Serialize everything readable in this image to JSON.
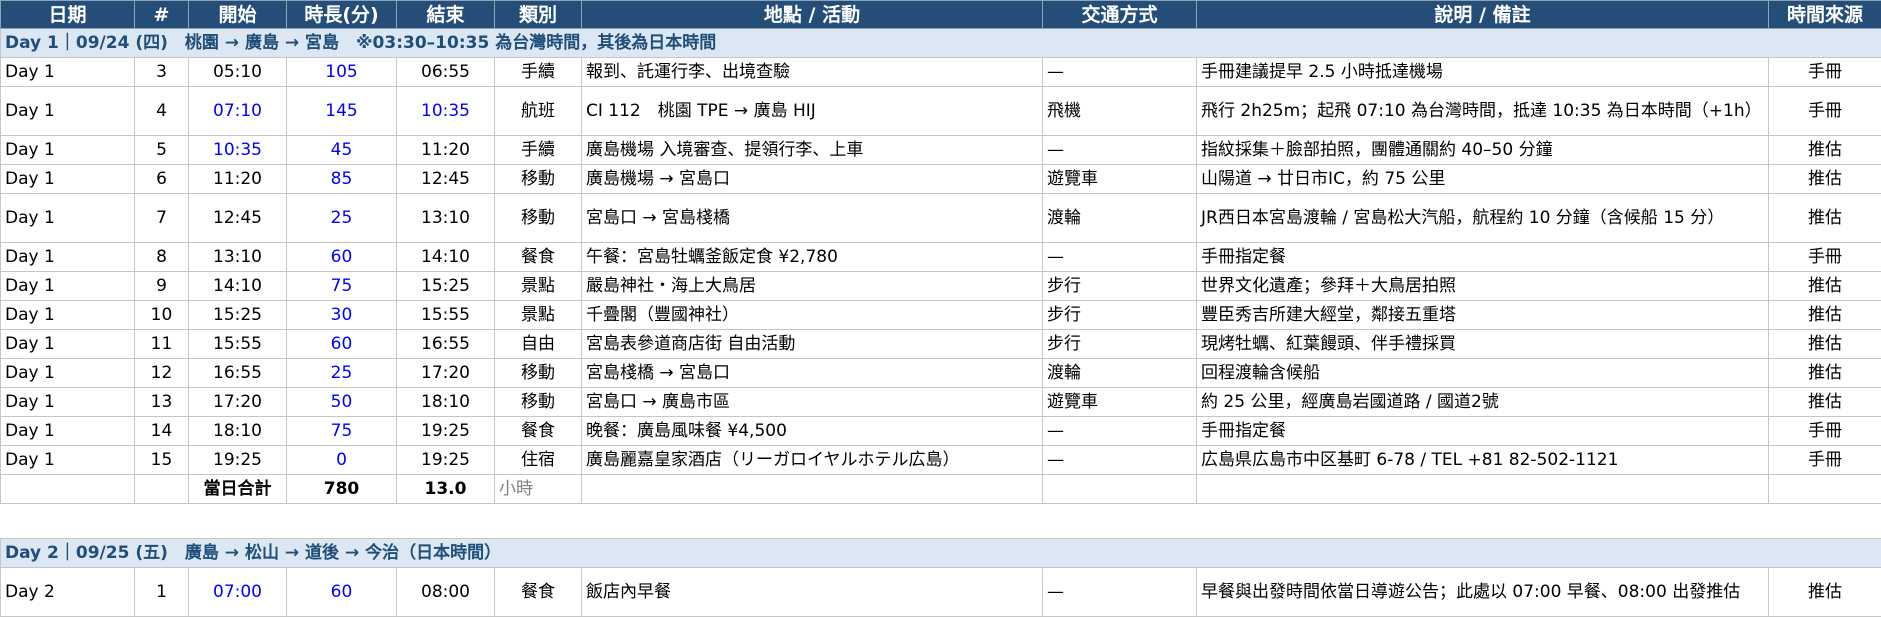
{
  "headers": [
    "日期",
    "#",
    "開始",
    "時長(分)",
    "結束",
    "類別",
    "地點 / 活動",
    "交通方式",
    "說明 / 備註",
    "時間來源"
  ],
  "days": [
    {
      "banner": "Day 1｜09/24 (四)　桃園 → 廣島 → 宮島　※03:30–10:35 為台灣時間，其後為日本時間",
      "rows": [
        {
          "day": "Day 1",
          "no": "3",
          "start": "05:10",
          "start_blue": false,
          "dur": "105",
          "end": "06:55",
          "end_blue": false,
          "cat": "手續",
          "place": "報到、託運行李、出境查驗",
          "trans": "—",
          "note": "手冊建議提早 2.5 小時抵達機場",
          "src": "手冊",
          "tall": false
        },
        {
          "day": "Day 1",
          "no": "4",
          "start": "07:10",
          "start_blue": true,
          "dur": "145",
          "end": "10:35",
          "end_blue": true,
          "cat": "航班",
          "place": "CI 112　桃園 TPE → 廣島 HIJ",
          "trans": "飛機",
          "note": "飛行 2h25m；起飛 07:10 為台灣時間，抵達 10:35 為日本時間（+1h）",
          "src": "手冊",
          "tall": true
        },
        {
          "day": "Day 1",
          "no": "5",
          "start": "10:35",
          "start_blue": true,
          "dur": "45",
          "end": "11:20",
          "end_blue": false,
          "cat": "手續",
          "place": "廣島機場 入境審查、提領行李、上車",
          "trans": "—",
          "note": "指紋採集＋臉部拍照，團體通關約 40–50 分鐘",
          "src": "推估",
          "tall": false
        },
        {
          "day": "Day 1",
          "no": "6",
          "start": "11:20",
          "start_blue": false,
          "dur": "85",
          "end": "12:45",
          "end_blue": false,
          "cat": "移動",
          "place": "廣島機場 → 宮島口",
          "trans": "遊覽車",
          "note": "山陽道 → 廿日市IC，約 75 公里",
          "src": "推估",
          "tall": false
        },
        {
          "day": "Day 1",
          "no": "7",
          "start": "12:45",
          "start_blue": false,
          "dur": "25",
          "end": "13:10",
          "end_blue": false,
          "cat": "移動",
          "place": "宮島口 → 宮島棧橋",
          "trans": "渡輪",
          "note": "JR西日本宮島渡輪 / 宮島松大汽船，航程約 10 分鐘（含候船 15 分）",
          "src": "推估",
          "tall": true
        },
        {
          "day": "Day 1",
          "no": "8",
          "start": "13:10",
          "start_blue": false,
          "dur": "60",
          "end": "14:10",
          "end_blue": false,
          "cat": "餐食",
          "place": "午餐：宮島牡蠣釜飯定食 ¥2,780",
          "trans": "—",
          "note": "手冊指定餐",
          "src": "手冊",
          "tall": false
        },
        {
          "day": "Day 1",
          "no": "9",
          "start": "14:10",
          "start_blue": false,
          "dur": "75",
          "end": "15:25",
          "end_blue": false,
          "cat": "景點",
          "place": "嚴島神社・海上大鳥居",
          "trans": "步行",
          "note": "世界文化遺產；參拜＋大鳥居拍照",
          "src": "推估",
          "tall": false
        },
        {
          "day": "Day 1",
          "no": "10",
          "start": "15:25",
          "start_blue": false,
          "dur": "30",
          "end": "15:55",
          "end_blue": false,
          "cat": "景點",
          "place": "千疊閣（豐國神社）",
          "trans": "步行",
          "note": "豐臣秀吉所建大經堂，鄰接五重塔",
          "src": "推估",
          "tall": false
        },
        {
          "day": "Day 1",
          "no": "11",
          "start": "15:55",
          "start_blue": false,
          "dur": "60",
          "end": "16:55",
          "end_blue": false,
          "cat": "自由",
          "place": "宮島表參道商店街 自由活動",
          "trans": "步行",
          "note": "現烤牡蠣、紅葉饅頭、伴手禮採買",
          "src": "推估",
          "tall": false
        },
        {
          "day": "Day 1",
          "no": "12",
          "start": "16:55",
          "start_blue": false,
          "dur": "25",
          "end": "17:20",
          "end_blue": false,
          "cat": "移動",
          "place": "宮島棧橋 → 宮島口",
          "trans": "渡輪",
          "note": "回程渡輪含候船",
          "src": "推估",
          "tall": false
        },
        {
          "day": "Day 1",
          "no": "13",
          "start": "17:20",
          "start_blue": false,
          "dur": "50",
          "end": "18:10",
          "end_blue": false,
          "cat": "移動",
          "place": "宮島口 → 廣島市區",
          "trans": "遊覽車",
          "note": "約 25 公里，經廣島岩國道路 / 國道2號",
          "src": "推估",
          "tall": false
        },
        {
          "day": "Day 1",
          "no": "14",
          "start": "18:10",
          "start_blue": false,
          "dur": "75",
          "end": "19:25",
          "end_blue": false,
          "cat": "餐食",
          "place": "晚餐：廣島風味餐 ¥4,500",
          "trans": "—",
          "note": "手冊指定餐",
          "src": "手冊",
          "tall": false
        },
        {
          "day": "Day 1",
          "no": "15",
          "start": "19:25",
          "start_blue": false,
          "dur": "0",
          "end": "19:25",
          "end_blue": false,
          "cat": "住宿",
          "place": "廣島麗嘉皇家酒店（リーガロイヤルホテル広島）",
          "trans": "—",
          "note": "広島県広島市中区基町 6-78 / TEL +81 82-502-1121",
          "src": "手冊",
          "tall": false
        }
      ],
      "total": {
        "label": "當日合計",
        "minutes": "780",
        "hours": "13.0",
        "unit": "小時"
      }
    },
    {
      "banner": "Day 2｜09/25 (五)　廣島 → 松山 → 道後 → 今治（日本時間）",
      "rows": [
        {
          "day": "Day 2",
          "no": "1",
          "start": "07:00",
          "start_blue": true,
          "dur": "60",
          "end": "08:00",
          "end_blue": false,
          "cat": "餐食",
          "place": "飯店內早餐",
          "trans": "—",
          "note": "早餐與出發時間依當日導遊公告；此處以 07:00 早餐、08:00 出發推估",
          "src": "推估",
          "tall": true
        }
      ]
    }
  ]
}
